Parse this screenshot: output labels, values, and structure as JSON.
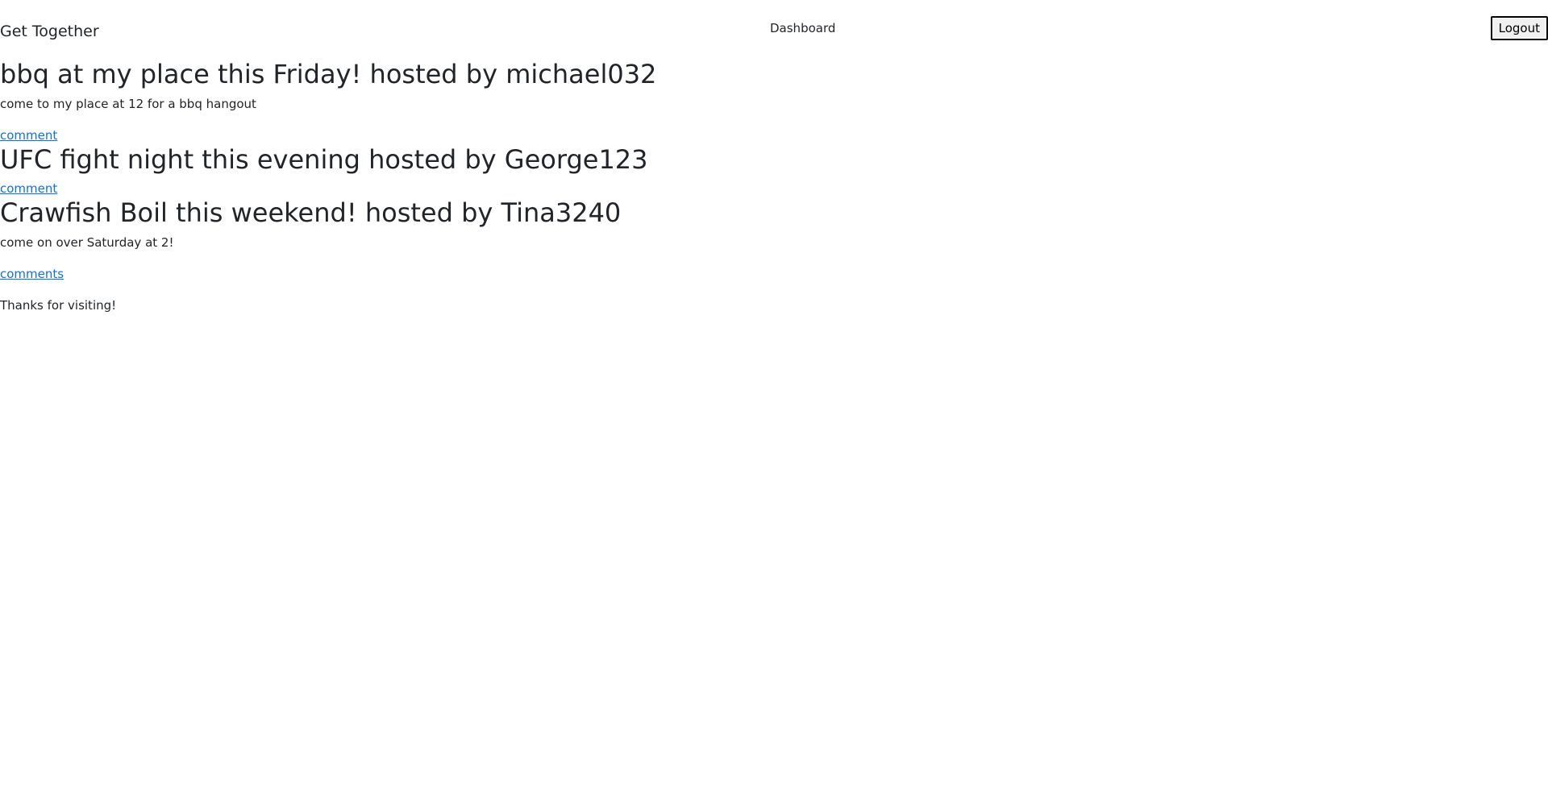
{
  "header": {
    "brand": "Get Together",
    "nav_dashboard": "Dashboard",
    "logout_label": "Logout"
  },
  "events": [
    {
      "title": "bbq at my place this Friday! hosted by michael032",
      "description": "come to my place at 12 for a bbq hangout",
      "link_label": "comment"
    },
    {
      "title": "UFC fight night this evening hosted by George123",
      "description": "",
      "link_label": "comment"
    },
    {
      "title": "Crawfish Boil this weekend! hosted by Tina3240",
      "description": "come on over Saturday at 2!",
      "link_label": "comments"
    }
  ],
  "footer": {
    "text": "Thanks for visiting!"
  },
  "colors": {
    "text": "#212529",
    "link": "#0d6efd",
    "background": "#ffffff"
  }
}
